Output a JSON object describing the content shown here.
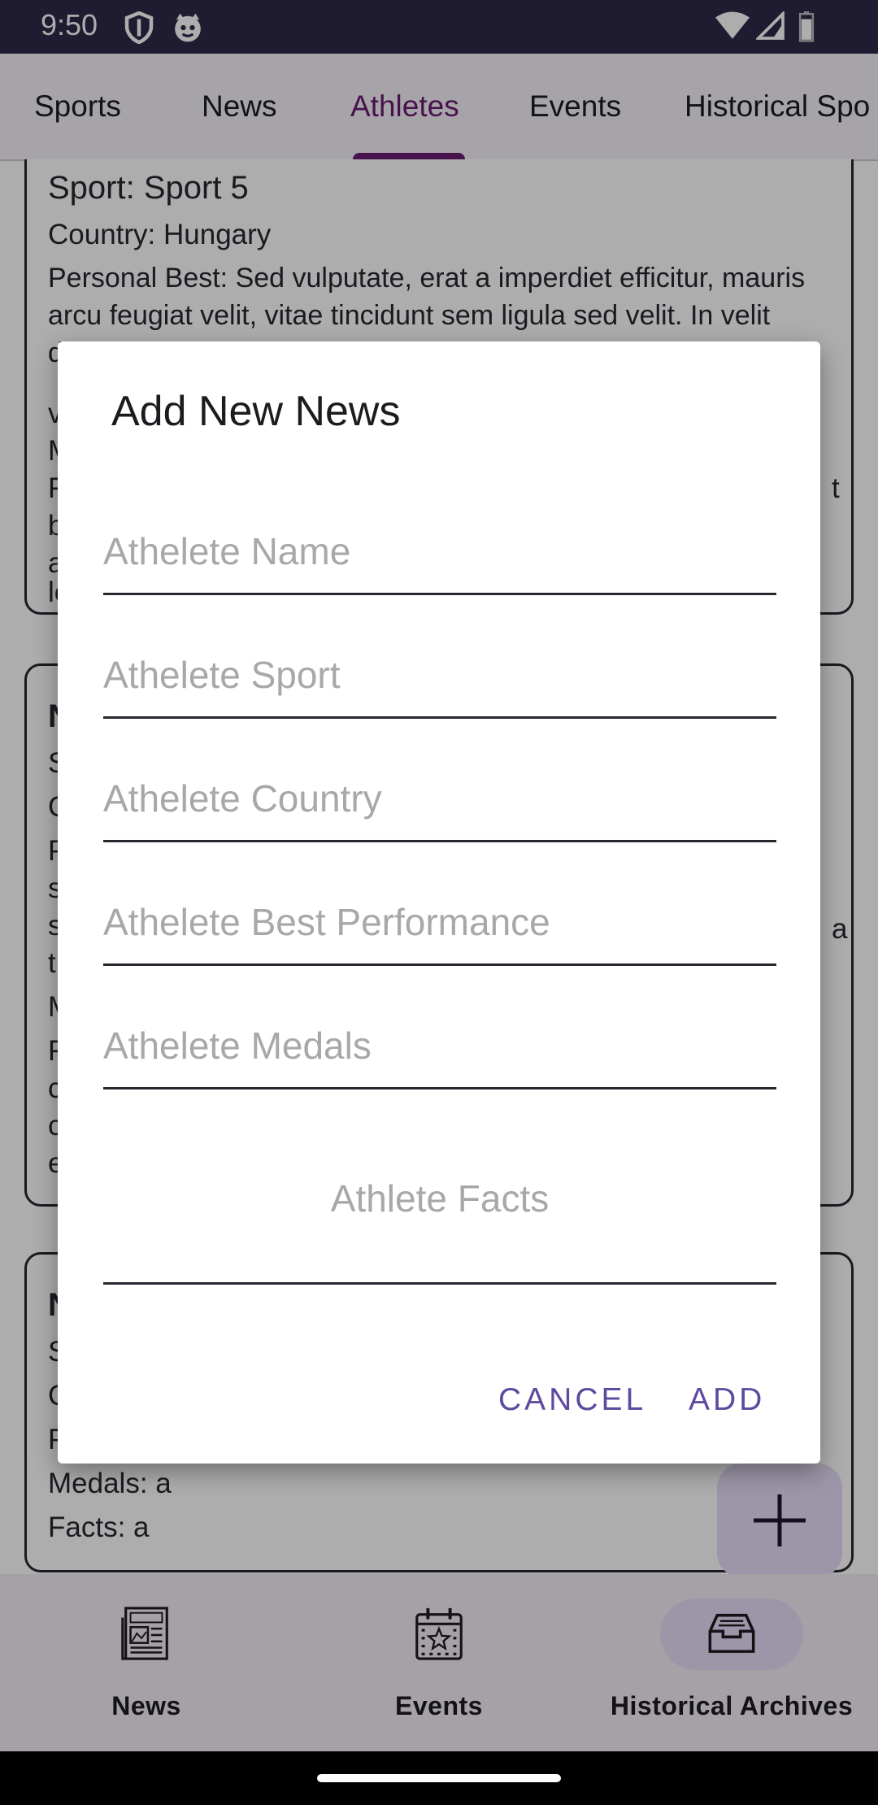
{
  "status_bar": {
    "time": "9:50"
  },
  "top_tabs": [
    "Sports",
    "News",
    "Athletes",
    "Events",
    "Historical Spo"
  ],
  "cards": [
    {
      "sport": "Sport: Sport 5",
      "country": "Country: Hungary",
      "personal_best": "Personal Best: Sed vulputate, erat a imperdiet efficitur, mauris arcu feugiat velit, vitae tincidunt sem ligula sed velit. In velit diam, gravida vitae condimentum a, lacinia"
    },
    {
      "lead_letters": [
        "N",
        "S",
        "C",
        "P",
        "s",
        "s",
        "t",
        "M",
        "F",
        "c",
        "c",
        "e"
      ],
      "tail_letter": "a"
    },
    {
      "lead_letters": [
        "N",
        "S",
        "C",
        "P"
      ],
      "medals": "Medals: a",
      "facts": "Facts: a"
    }
  ],
  "card1_obscured_letters": [
    "v",
    "M",
    "F",
    "b",
    "a",
    "le"
  ],
  "card1_tail_letter": "t",
  "dialog": {
    "title": "Add New News",
    "fields": [
      {
        "placeholder": "Athelete Name"
      },
      {
        "placeholder": "Athelete Sport"
      },
      {
        "placeholder": "Athelete Country"
      },
      {
        "placeholder": "Athelete Best Performance"
      },
      {
        "placeholder": "Athelete Medals"
      },
      {
        "placeholder": "Athlete Facts"
      }
    ],
    "cancel_label": "CANCEL",
    "add_label": "ADD"
  },
  "bottom_nav": {
    "items": [
      {
        "label": "News",
        "icon": "newspaper-icon"
      },
      {
        "label": "Events",
        "icon": "calendar-star-icon"
      },
      {
        "label": "Historical Archives",
        "icon": "archive-inbox-icon",
        "selected": true
      }
    ]
  },
  "fab": {
    "icon": "plus-icon"
  },
  "colors": {
    "accent": "#6a1b72",
    "dialog_button": "#5e4a9e",
    "status_bar": "#2e2848",
    "nav_pill": "#e8def8"
  }
}
